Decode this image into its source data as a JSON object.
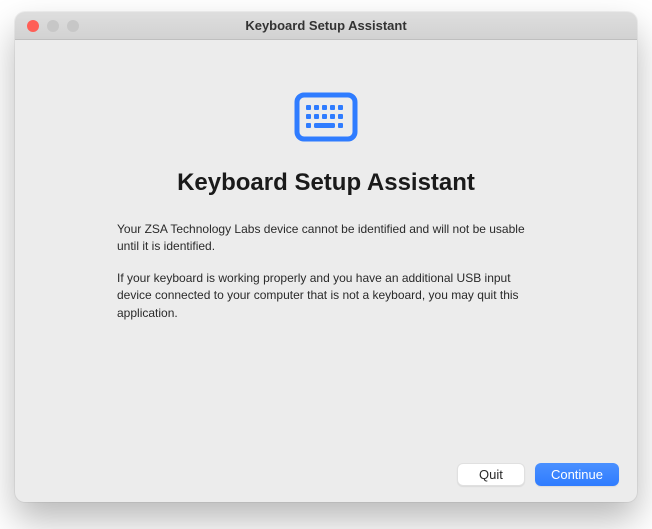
{
  "window": {
    "title": "Keyboard Setup Assistant"
  },
  "icon": {
    "name": "keyboard-icon",
    "color": "#2f7cff"
  },
  "main": {
    "heading": "Keyboard Setup Assistant",
    "paragraph1": "Your ZSA Technology Labs device cannot be identified and will not be usable until it is identified.",
    "paragraph2": "If your keyboard is working properly and you have an additional USB input device connected to your computer that is not a keyboard, you may quit this application."
  },
  "footer": {
    "quit_label": "Quit",
    "continue_label": "Continue"
  }
}
